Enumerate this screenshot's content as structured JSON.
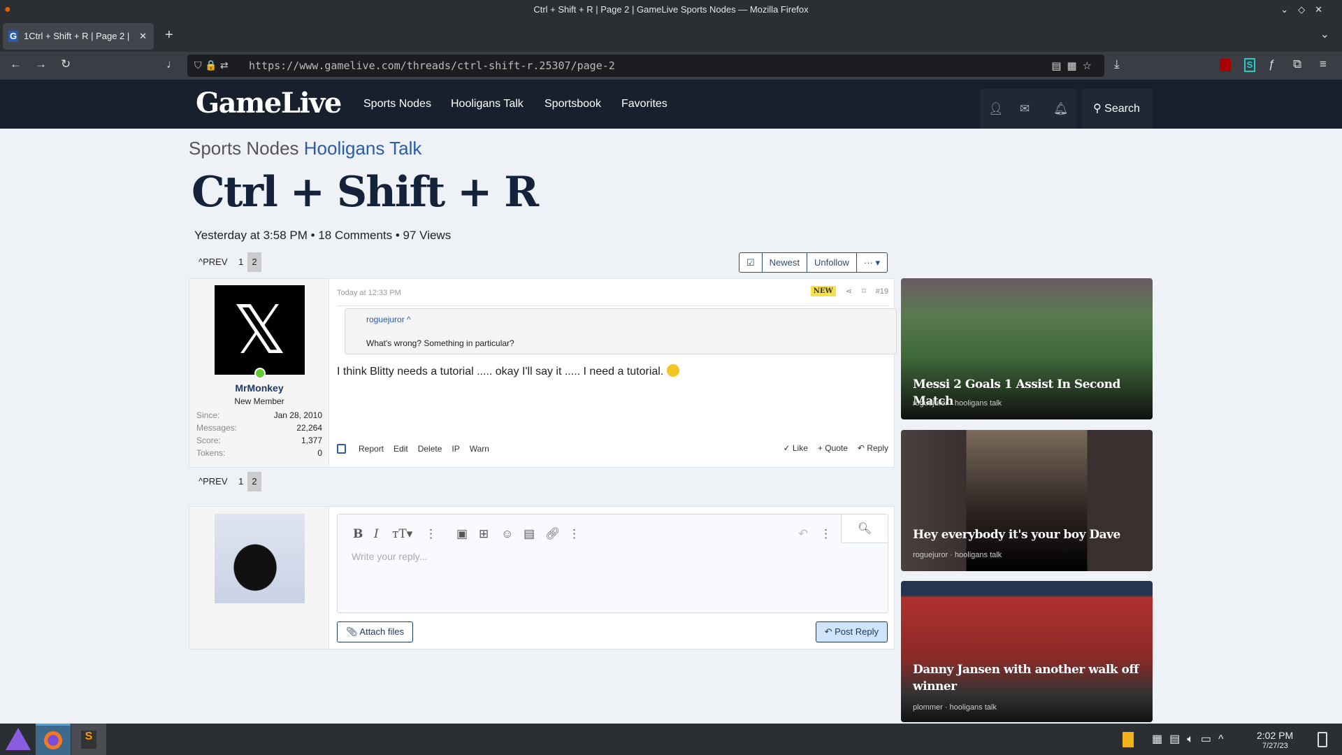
{
  "window": {
    "title": "Ctrl + Shift + R | Page 2 | GameLive Sports Nodes — Mozilla Firefox"
  },
  "tab": {
    "label": "1Ctrl + Shift + R | Page 2 |"
  },
  "url": "https://www.gamelive.com/threads/ctrl-shift-r.25307/page-2",
  "site": {
    "logo": "GameLive",
    "nav": [
      "Sports Nodes",
      "Hooligans Talk",
      "Sportsbook",
      "Favorites"
    ],
    "search": "Search"
  },
  "breadcrumb": {
    "parent": "Sports Nodes",
    "current": "Hooligans Talk"
  },
  "thread": {
    "title": "Ctrl + Shift + R",
    "meta": "Yesterday at 3:58 PM • 18 Comments • 97 Views"
  },
  "pager": {
    "prev": "PREV",
    "pages": [
      "1",
      "2"
    ],
    "current": "2"
  },
  "thread_buttons": {
    "newest": "Newest",
    "unfollow": "Unfollow",
    "more": "··· ▾"
  },
  "post": {
    "time": "Today at 12:33 PM",
    "badge": "NEW",
    "number": "#19",
    "user": {
      "name": "MrMonkey",
      "role": "New Member",
      "stats": [
        {
          "k": "Since:",
          "v": "Jan 28, 2010"
        },
        {
          "k": "Messages:",
          "v": "22,264"
        },
        {
          "k": "Score:",
          "v": "1,377"
        },
        {
          "k": "Tokens:",
          "v": "0"
        }
      ]
    },
    "quote": {
      "author": "roguejuror ^",
      "text": "What's wrong? Something in particular?"
    },
    "body": "I think Blitty needs a tutorial ..... okay I'll say it ..... I need a tutorial.",
    "actions": [
      "Report",
      "Edit",
      "Delete",
      "IP",
      "Warn"
    ],
    "like": "✓ Like",
    "quote_btn": "+ Quote",
    "reply": "↶ Reply"
  },
  "editor": {
    "placeholder": "Write your reply...",
    "attach": "Attach files",
    "post": "Post Reply"
  },
  "cards": [
    {
      "title": "Messi 2 Goals 1 Assist In Second Match",
      "sub": "roguejuror · hooligans talk"
    },
    {
      "title": "Hey everybody it's your boy Dave",
      "sub": "roguejuror · hooligans talk"
    },
    {
      "title": "Danny Jansen with another walk off winner",
      "sub": "plommer · hooligans talk"
    }
  ],
  "taskbar": {
    "time": "2:02 PM",
    "date": "7/27/23"
  },
  "colors": {
    "header": "#18202d",
    "accent": "#2a5caa",
    "bg": "#eef1f6",
    "badge": "#f5e14a"
  }
}
